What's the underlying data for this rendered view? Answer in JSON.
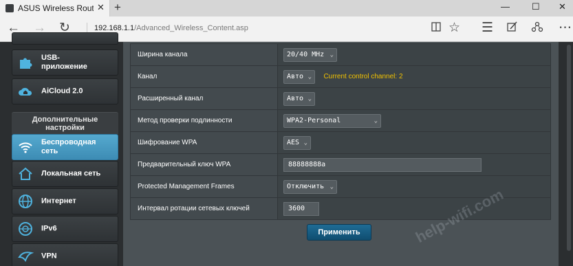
{
  "browser": {
    "tab_title": "ASUS Wireless Router R",
    "address_host": "192.168.1.1",
    "address_path": "/Advanced_Wireless_Content.asp",
    "icons": [
      "back-icon",
      "forward-icon",
      "refresh-icon",
      "reading-view-icon",
      "favorite-star-icon",
      "hub-icon",
      "web-note-icon",
      "share-icon"
    ]
  },
  "sidebar": {
    "items": [
      {
        "label": "USB-\nприложение",
        "icon": "puzzle-icon"
      },
      {
        "label": "AiCloud 2.0",
        "icon": "cloud-house-icon"
      }
    ],
    "advanced_header": "Дополнительные\nнастройки",
    "advanced_items": [
      {
        "label": "Беспроводная\nсеть",
        "icon": "wifi-icon",
        "active": true
      },
      {
        "label": "Локальная сеть",
        "icon": "home-icon"
      },
      {
        "label": "Интернет",
        "icon": "globe-icon"
      },
      {
        "label": "IPv6",
        "icon": "ipv6-globe-icon"
      },
      {
        "label": "VPN",
        "icon": "vpn-icon"
      }
    ]
  },
  "settings": {
    "rows": [
      {
        "label": "Ширина канала",
        "value": "20/40 MHz"
      },
      {
        "label": "Канал",
        "value": "Авто",
        "hint": "Current control channel: 2"
      },
      {
        "label": "Расширенный канал",
        "value": "Авто"
      },
      {
        "label": "Метод проверки подлинности",
        "value": "WPA2-Personal"
      },
      {
        "label": "Шифрование WPA",
        "value": "AES"
      },
      {
        "label": "Предварительный ключ WPA",
        "value": "88888888a"
      },
      {
        "label": "Protected Management Frames",
        "value": "Отключить"
      },
      {
        "label": "Интервал ротации сетевых ключей",
        "value": "3600"
      }
    ],
    "apply_label": "Применить"
  },
  "watermark": "help-wifi.com",
  "colors": {
    "accent": "#3d8cb4",
    "hint": "#f2c200",
    "apply_button": "#1a5f86"
  }
}
